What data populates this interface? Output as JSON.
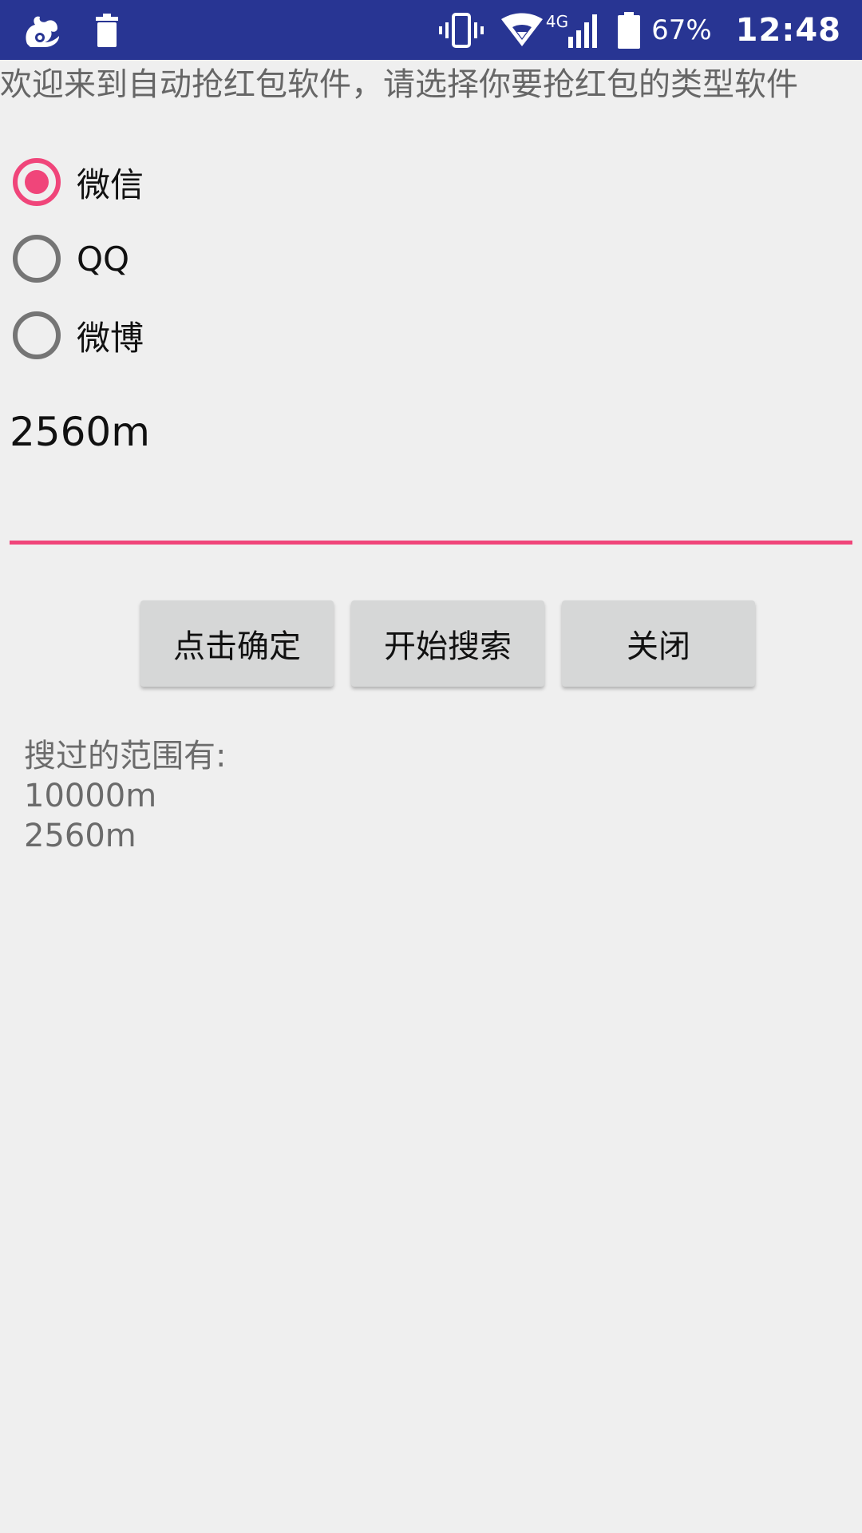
{
  "status_bar": {
    "battery_percent": "67%",
    "time": "12:48",
    "network_label": "4G",
    "left_icons": [
      "uc-browser-squirrel-icon",
      "trash-icon"
    ],
    "right_icons": [
      "vibrate-icon",
      "wifi-icon",
      "signal-icon",
      "battery-icon"
    ],
    "background_color": "#283593"
  },
  "welcome_text": "欢迎来到自动抢红包软件，请选择你要抢红包的类型软件",
  "radio_options": [
    {
      "label": "微信",
      "checked": true
    },
    {
      "label": "QQ",
      "checked": false
    },
    {
      "label": "微博",
      "checked": false
    }
  ],
  "edit_field": {
    "value": "2560m",
    "accent_color": "#f0457a"
  },
  "buttons": {
    "confirm_label": "点击确定",
    "search_label": "开始搜索",
    "close_label": "关闭"
  },
  "history": {
    "header": "搜过的范围有:",
    "items": [
      "10000m",
      "2560m"
    ]
  }
}
